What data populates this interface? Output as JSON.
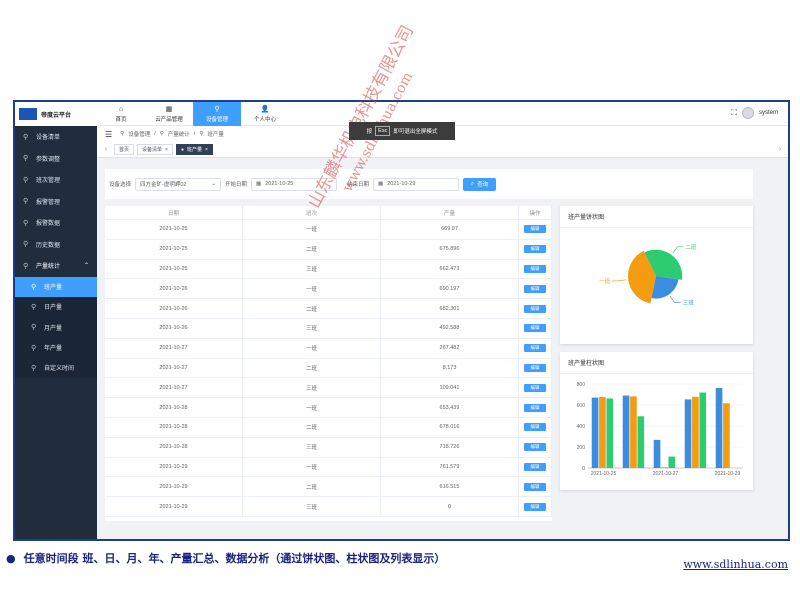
{
  "app": {
    "title": "帝度云平台"
  },
  "topnav": [
    {
      "label": "首页",
      "icon": "home-icon",
      "glyph": "⌂"
    },
    {
      "label": "云产品管理",
      "icon": "grid-icon",
      "glyph": "▦"
    },
    {
      "label": "设备管理",
      "icon": "link-icon",
      "glyph": "⚲"
    },
    {
      "label": "个人中心",
      "icon": "user-icon",
      "glyph": "👤"
    }
  ],
  "user": {
    "name": "system"
  },
  "esc_toast": {
    "pre": "按",
    "key": "Esc",
    "post": "即可退出全屏模式"
  },
  "breadcrumb": [
    "设备管理",
    "产量统计",
    "班产量"
  ],
  "tabs": [
    {
      "label": "首页"
    },
    {
      "label": "设备清单"
    },
    {
      "label": "班产量"
    }
  ],
  "sidebar": {
    "items": [
      {
        "label": "设备清单"
      },
      {
        "label": "参数调整"
      },
      {
        "label": "班次管理"
      },
      {
        "label": "报警管理"
      },
      {
        "label": "报警数据"
      },
      {
        "label": "历史数据"
      },
      {
        "label": "产量统计"
      }
    ],
    "sub_items": [
      {
        "label": "班产量"
      },
      {
        "label": "日产量"
      },
      {
        "label": "月产量"
      },
      {
        "label": "年产量"
      },
      {
        "label": "自定义时间"
      }
    ]
  },
  "filter": {
    "device_label": "设备选择",
    "device_value": "四方金矿-虚明岬02",
    "start_label": "开始日期",
    "start_value": "2021-10-25",
    "end_label": "结束日期",
    "end_value": "2021-10-29",
    "query_label": "查询"
  },
  "table": {
    "headers": [
      "日期",
      "班次",
      "产量",
      "操作"
    ],
    "edit_label": "编辑",
    "rows": [
      [
        "2021-10-25",
        "一班",
        "669.97"
      ],
      [
        "2021-10-25",
        "二班",
        "675.896"
      ],
      [
        "2021-10-25",
        "三班",
        "662.473"
      ],
      [
        "2021-10-26",
        "一班",
        "690.197"
      ],
      [
        "2021-10-26",
        "二班",
        "682.301"
      ],
      [
        "2021-10-26",
        "三班",
        "492.588"
      ],
      [
        "2021-10-27",
        "一班",
        "267.482"
      ],
      [
        "2021-10-27",
        "二班",
        "8.173"
      ],
      [
        "2021-10-27",
        "三班",
        "109.041"
      ],
      [
        "2021-10-28",
        "一班",
        "653.439"
      ],
      [
        "2021-10-28",
        "二班",
        "678.016"
      ],
      [
        "2021-10-28",
        "三班",
        "718.726"
      ],
      [
        "2021-10-29",
        "一班",
        "761.579"
      ],
      [
        "2021-10-29",
        "二班",
        "616.515"
      ],
      [
        "2021-10-29",
        "三班",
        "0"
      ]
    ]
  },
  "colors": {
    "one": "#f39c12",
    "two": "#2ecc71",
    "three": "#3c8dde",
    "accent": "#409eff"
  },
  "chart_data": [
    {
      "type": "pie",
      "title": "班产量饼状图",
      "labels": [
        "一班",
        "二班",
        "三班"
      ],
      "values": [
        3042.667,
        2661.001,
        1982.828
      ]
    },
    {
      "type": "bar",
      "title": "班产量柱状图",
      "categories": [
        "2021-10-25",
        "2021-10-26",
        "2021-10-27",
        "2021-10-28",
        "2021-10-29"
      ],
      "x_tick_labels": [
        "2021-10-25",
        "2021-10-27",
        "2021-10-29"
      ],
      "y_ticks": [
        0,
        200,
        400,
        600,
        800
      ],
      "ylim": [
        0,
        800
      ],
      "series": [
        {
          "name": "一班",
          "values": [
            669.97,
            690.197,
            267.482,
            653.439,
            761.579
          ]
        },
        {
          "name": "二班",
          "values": [
            675.896,
            682.301,
            8.173,
            678.016,
            616.515
          ]
        },
        {
          "name": "三班",
          "values": [
            662.473,
            492.588,
            109.041,
            718.726,
            0
          ]
        }
      ]
    }
  ],
  "watermark": {
    "line1": "山东麟华机电科技有限公司",
    "line2": "www.sdlinhua.com"
  },
  "caption": {
    "bullet": "●",
    "text": "任意时间段 班、日、月、年、产量汇总、数据分析（通过饼状图、柱状图及列表显示）"
  },
  "footer_url": "www.sdlinhua.com"
}
